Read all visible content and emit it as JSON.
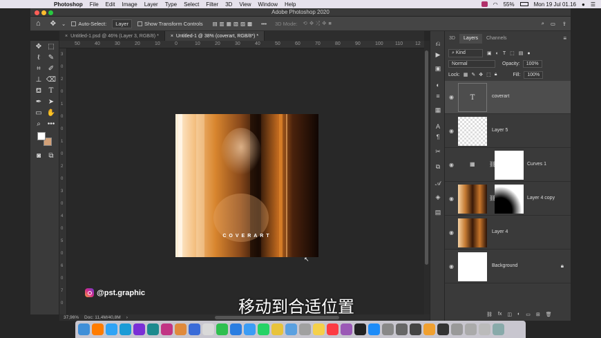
{
  "menubar": {
    "app": "Photoshop",
    "items": [
      "File",
      "Edit",
      "Image",
      "Layer",
      "Type",
      "Select",
      "Filter",
      "3D",
      "View",
      "Window",
      "Help"
    ],
    "battery": "55%",
    "clock": "Mon 19 Jul  01.16"
  },
  "window": {
    "title": "Adobe Photoshop 2020"
  },
  "options": {
    "auto_select_label": "Auto-Select:",
    "auto_select_value": "Layer",
    "transform_controls": "Show Transform Controls",
    "mode_3d": "3D Mode:"
  },
  "tabs": [
    {
      "label": "Untitled-1.psd @ 46% (Layer 3, RGB/8) *"
    },
    {
      "label": "Untitled-1 @ 38% (coverart, RGB/8*) *"
    }
  ],
  "ruler": {
    "h_ticks": [
      "50",
      "40",
      "30",
      "20",
      "10",
      "0",
      "10",
      "20",
      "30",
      "40",
      "50",
      "60",
      "70",
      "80",
      "90",
      "100",
      "110",
      "12"
    ],
    "v_ticks": [
      "3",
      "0",
      "2",
      "0",
      "1",
      "0",
      "0",
      "1",
      "0",
      "2",
      "0",
      "3",
      "0",
      "4",
      "0",
      "5",
      "0",
      "6",
      "0",
      "7",
      "0"
    ]
  },
  "artwork": {
    "text": "COVERART"
  },
  "status": {
    "zoom": "37,96%",
    "doc": "Doc: 11,4M/40,8M"
  },
  "layers_panel": {
    "tabs": [
      "3D",
      "Layers",
      "Channels"
    ],
    "filter_kind": "Kind",
    "blend_mode": "Normal",
    "opacity_label": "Opacity:",
    "opacity_value": "100%",
    "lock_label": "Lock:",
    "fill_label": "Fill:",
    "fill_value": "100%",
    "layers": [
      {
        "name": "coverart"
      },
      {
        "name": "Layer 5"
      },
      {
        "name": "Curves 1"
      },
      {
        "name": "Layer 4 copy"
      },
      {
        "name": "Layer 4"
      },
      {
        "name": "Background"
      }
    ]
  },
  "overlay": {
    "instagram": "@pst.graphic",
    "subtitle": "移动到合适位置"
  },
  "dock_icons": [
    "finder-icon",
    "illustrator-icon",
    "photoshop-icon",
    "lightroom-icon",
    "premiere-icon",
    "audition-icon",
    "instagram-icon",
    "avatar-icon",
    "messenger-icon",
    "calendar-icon",
    "facetime-icon",
    "edge-icon",
    "safari-icon",
    "whatsapp-icon",
    "chrome-icon",
    "app-icon",
    "app-icon-2",
    "notes-icon",
    "music-icon",
    "podcasts-icon",
    "appletv-icon",
    "appstore-icon",
    "app-icon-3",
    "app-icon-4",
    "app-icon-5",
    "app-icon-6",
    "app-icon-7",
    "app-icon-8",
    "app-icon-9",
    "app-icon-10",
    "trash-icon"
  ]
}
